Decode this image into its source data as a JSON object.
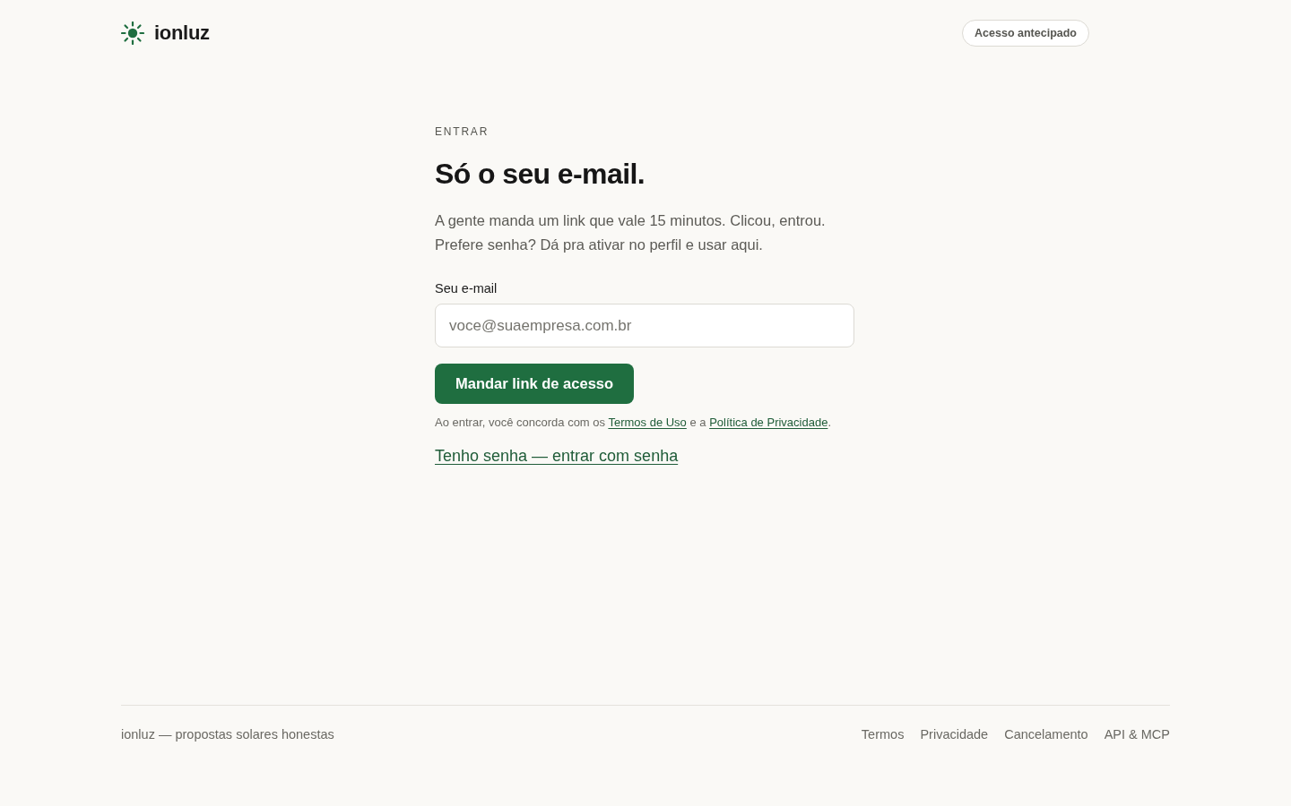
{
  "header": {
    "brand": "ionluz",
    "action": "Acesso antecipado"
  },
  "login": {
    "eyebrow": "ENTRAR",
    "title": "Só o seu e-mail.",
    "intro": [
      "A gente manda um link que vale 15 minutos. Clicou, entrou.",
      "Prefere senha? Dá pra ativar no perfil e usar aqui."
    ],
    "email_field": {
      "label": "Seu e-mail",
      "placeholder": "voce@suaempresa.com.br"
    },
    "submit": "Mandar link de acesso",
    "consent": [
      {
        "kind": "text",
        "text": "Ao entrar, você concorda com os "
      },
      {
        "kind": "link",
        "text": "Termos de Uso"
      },
      {
        "kind": "text",
        "text": " e a "
      },
      {
        "kind": "link",
        "text": "Política de Privacidade"
      },
      {
        "kind": "text",
        "text": "."
      }
    ],
    "password_link": "Tenho senha — entrar com senha"
  },
  "footer": {
    "tagline": "ionluz — propostas solares honestas",
    "links": [
      "Termos",
      "Privacidade",
      "Cancelamento",
      "API & MCP"
    ]
  }
}
